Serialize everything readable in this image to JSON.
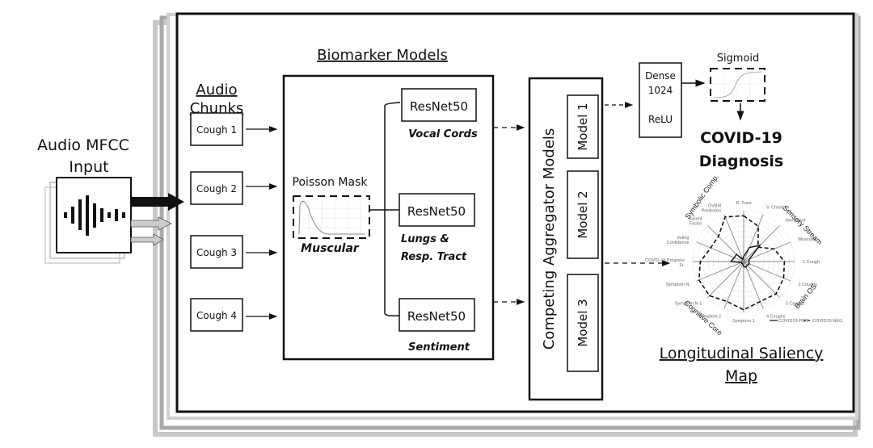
{
  "input": {
    "title_line1": "Audio MFCC",
    "title_line2": "Input"
  },
  "chunks": {
    "title_line1": "Audio",
    "title_line2": "Chunks",
    "items": [
      "Cough 1",
      "Cough 2",
      "Cough 3",
      "Cough 4"
    ]
  },
  "biomarker": {
    "title": "Biomarker Models",
    "poisson_label": "Poisson Mask",
    "poisson_caption": "Muscular",
    "models": [
      {
        "label": "ResNet50",
        "caption_line1": "Vocal Cords",
        "caption_line2": ""
      },
      {
        "label": "ResNet50",
        "caption_line1": "Lungs &",
        "caption_line2": "Resp. Tract"
      },
      {
        "label": "ResNet50",
        "caption_line1": "Sentiment",
        "caption_line2": ""
      }
    ]
  },
  "aggregator": {
    "title": "Competing Aggregator Models",
    "models": [
      "Model 1",
      "Model 2",
      "Model 3"
    ]
  },
  "dense": {
    "line1": "Dense",
    "line2": "1024",
    "line3": "ReLU"
  },
  "sigmoid": {
    "title": "Sigmoid"
  },
  "output": {
    "line1": "COVID-19",
    "line2": "Diagnosis"
  },
  "saliency": {
    "title_line1": "Longitudinal Saliency",
    "title_line2": "Map",
    "groups": [
      "Symbolic Comp.",
      "Sensory Stream",
      "Brain OS",
      "Cognitive Core"
    ]
  },
  "chart_data": {
    "type": "radar",
    "axes": [
      "R. Tract",
      "V. Chords",
      "Sentiment",
      "Muscular",
      "1 Cough",
      "2 Coughs",
      "3 Coughs",
      "4 Coughs",
      "Symptom 1",
      "Symptom 2",
      "Symptom N-1",
      "Symptom N",
      "COVID-19 Progress Fr.",
      "Voting Confidence",
      "Salient Factor",
      "OVBM Prediction"
    ],
    "range": [
      0,
      100
    ],
    "grid": true,
    "legend_position": "bottom-right",
    "series": [
      {
        "name": "COVID19-POS",
        "style": "solid",
        "values": [
          10,
          30,
          45,
          12,
          10,
          12,
          10,
          12,
          10,
          5,
          5,
          5,
          25,
          20,
          20,
          5
        ]
      },
      {
        "name": "COVID19-NEG",
        "style": "dashed",
        "values": [
          90,
          75,
          40,
          65,
          80,
          85,
          90,
          85,
          95,
          85,
          95,
          95,
          85,
          70,
          70,
          95
        ]
      }
    ]
  },
  "colors": {
    "frame_shadow": "#bdbdbd",
    "line": "#111111",
    "grid": "#cccccc"
  }
}
